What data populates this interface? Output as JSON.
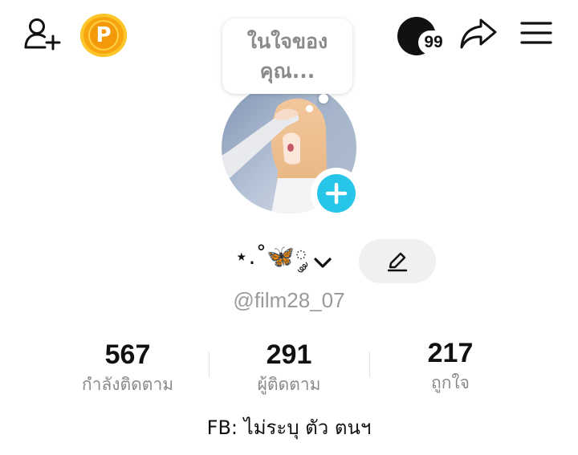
{
  "header": {
    "coin_letter": "P",
    "notification_count": "99",
    "icons": {
      "add_friend": "person-add-icon",
      "coins": "coin-p-icon",
      "notifications": "notification-avatar-icon",
      "share": "share-arrow-icon",
      "menu": "hamburger-menu-icon"
    }
  },
  "profile": {
    "thought_bubble": "ในใจของคุณ...",
    "display_name": "⋆.˚🦋༘",
    "username": "@film28_07",
    "bio": "FB: ไม่ระบุ ตัว ตนฯ",
    "add_photo_color": "#27c6e8"
  },
  "stats": [
    {
      "value": "567",
      "label": "กำลังติดตาม"
    },
    {
      "value": "291",
      "label": "ผู้ติดตาม"
    },
    {
      "value": "217",
      "label": "ถูกใจ"
    }
  ]
}
